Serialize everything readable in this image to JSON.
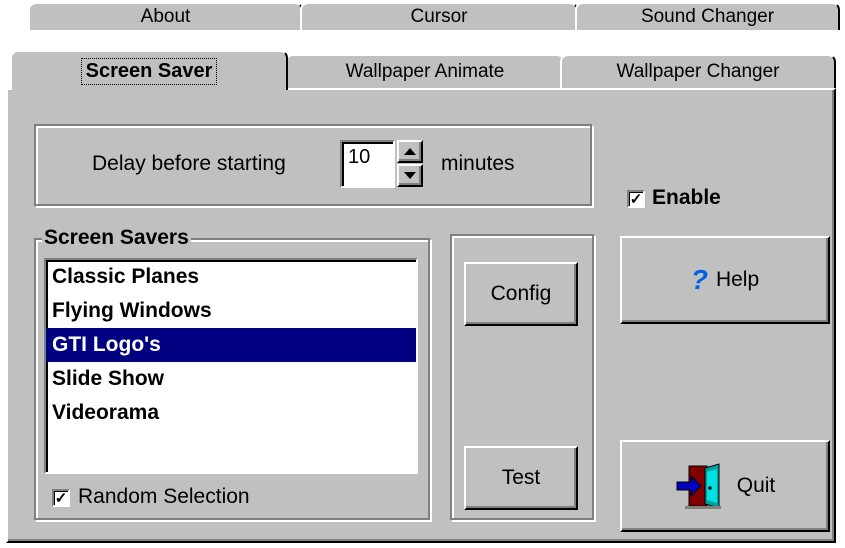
{
  "tabs": {
    "back_row": [
      "About",
      "Cursor",
      "Sound Changer"
    ],
    "front_row": [
      "Screen Saver",
      "Wallpaper Animate",
      "Wallpaper Changer"
    ],
    "active": "Screen Saver"
  },
  "delay": {
    "prefix": "Delay before starting",
    "value": "10",
    "suffix": "minutes"
  },
  "enable": {
    "label": "Enable",
    "checked": true
  },
  "screen_savers": {
    "title": "Screen Savers",
    "items": [
      "Classic Planes",
      "Flying Windows",
      "GTI Logo's",
      "Slide Show",
      "Videorama"
    ],
    "selected": "GTI Logo's"
  },
  "random_selection": {
    "label": "Random Selection",
    "checked": true
  },
  "buttons": {
    "config": "Config",
    "test": "Test",
    "help": "Help",
    "quit": "Quit"
  },
  "colors": {
    "face": "#c0c0c0",
    "selection": "#000080",
    "help_icon": "#0060e0"
  },
  "icons": {
    "help": "question-mark-icon",
    "quit": "exit-door-icon"
  }
}
